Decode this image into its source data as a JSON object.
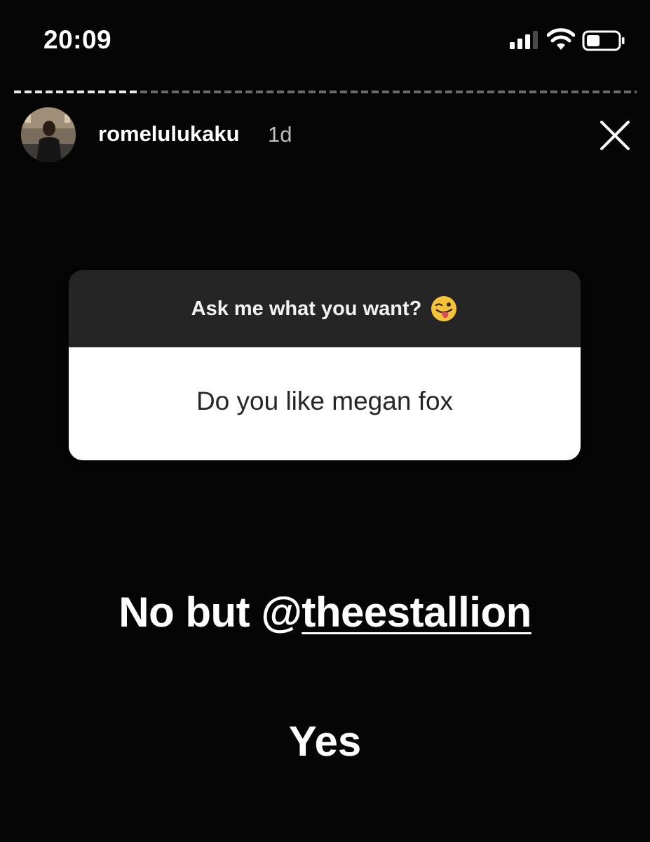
{
  "status_bar": {
    "time": "20:09",
    "icons": [
      "signal-icon",
      "wifi-icon",
      "battery-icon"
    ]
  },
  "story": {
    "username": "romelulukaku",
    "time_ago": "1d",
    "progress_fraction": 0.2
  },
  "question_sticker": {
    "prompt": "Ask me what you want?",
    "prompt_emoji": "winking-face-with-tongue-icon",
    "question": "Do you like megan fox"
  },
  "answer": {
    "line1_prefix": "No but @",
    "line1_mention": "theestallion",
    "line2": "Yes"
  },
  "colors": {
    "background": "#050505",
    "sticker_header": "#252525",
    "sticker_body": "#ffffff",
    "question_text": "#262626"
  }
}
